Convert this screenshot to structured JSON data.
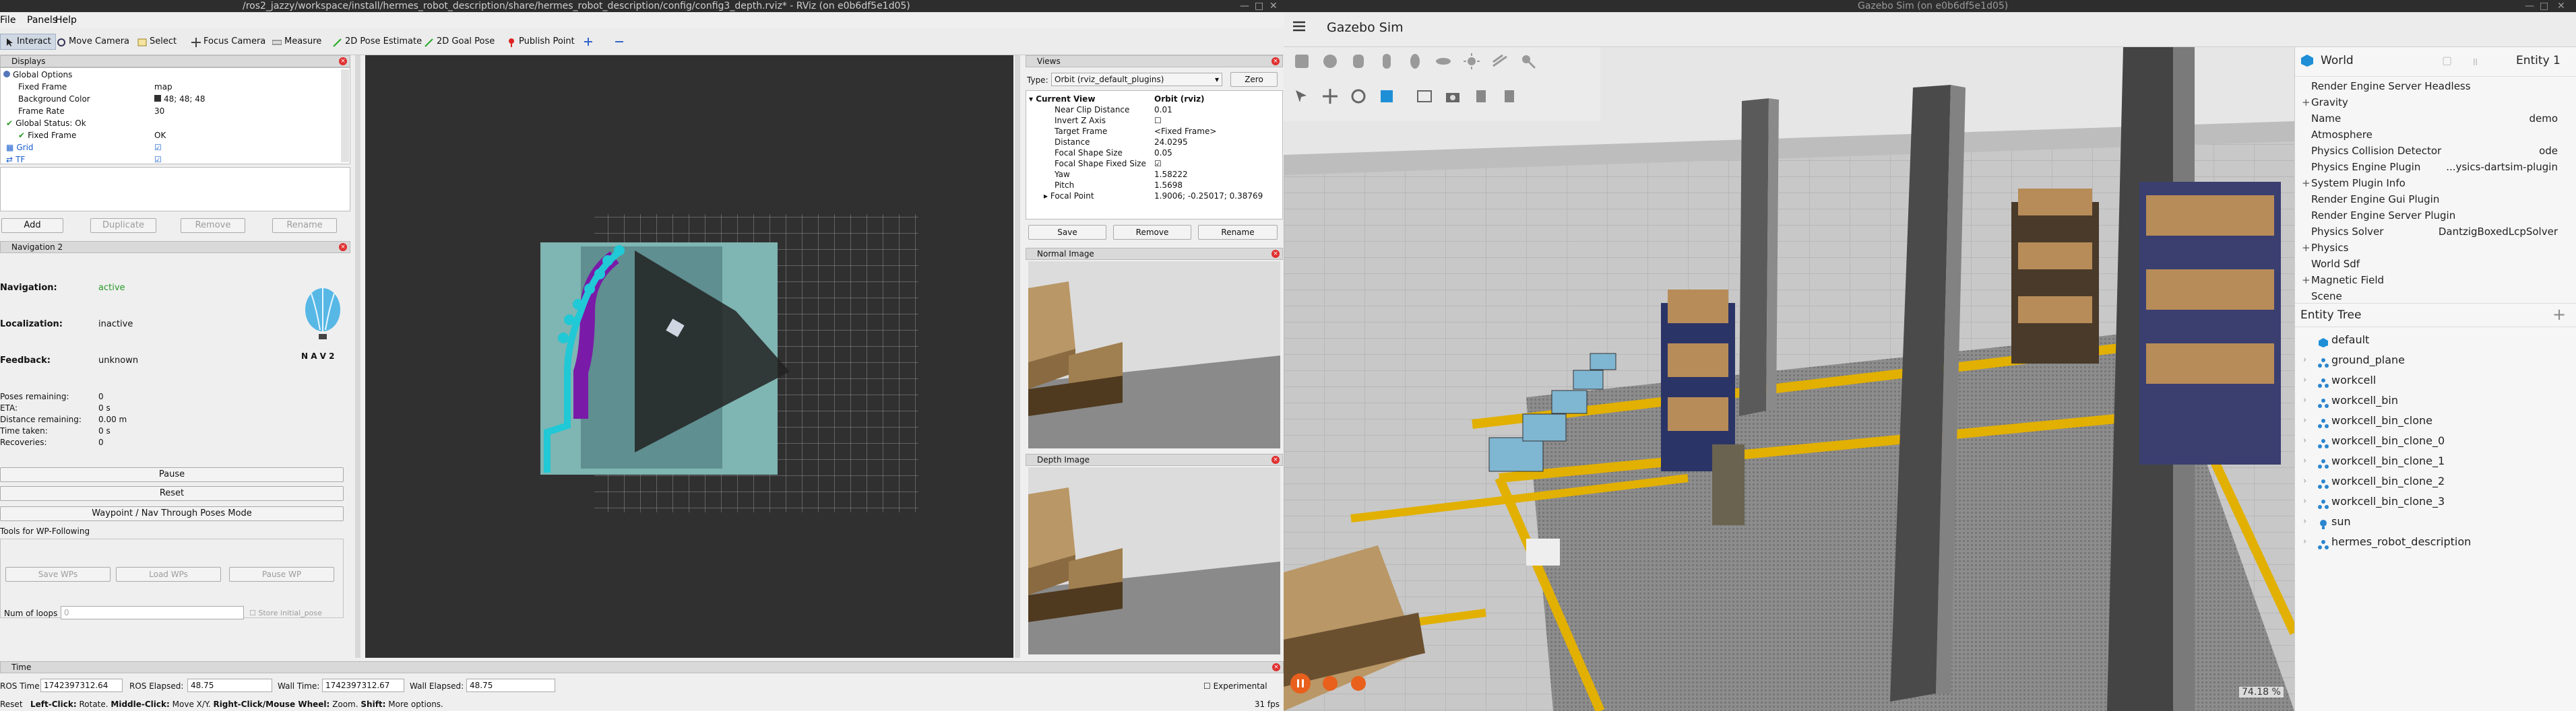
{
  "rviz": {
    "window_title": "/ros2_jazzy/workspace/install/hermes_robot_description/share/hermes_robot_description/config/config3_depth.rviz* - RViz (on e0b6df5e1d05)",
    "menu": [
      "File",
      "Panels",
      "Help"
    ],
    "toolbar": [
      "Interact",
      "Move Camera",
      "Select",
      "Focus Camera",
      "Measure",
      "2D Pose Estimate",
      "2D Goal Pose",
      "Publish Point"
    ],
    "displays": {
      "title": "Displays",
      "rows": [
        {
          "label": "Global Options",
          "value": ""
        },
        {
          "label": "Fixed Frame",
          "value": "map"
        },
        {
          "label": "Background Color",
          "value": "48; 48; 48"
        },
        {
          "label": "Frame Rate",
          "value": "30"
        },
        {
          "label": "Global Status: Ok",
          "value": ""
        },
        {
          "label": "Fixed Frame",
          "value": "OK"
        },
        {
          "label": "Grid",
          "value": ""
        },
        {
          "label": "TF",
          "value": ""
        }
      ],
      "buttons": [
        "Add",
        "Duplicate",
        "Remove",
        "Rename"
      ]
    },
    "nav2": {
      "title": "Navigation 2",
      "status": [
        {
          "label": "Navigation:",
          "value": "active"
        },
        {
          "label": "Localization:",
          "value": "inactive"
        },
        {
          "label": "Feedback:",
          "value": "unknown"
        }
      ],
      "logo_text": "N A V 2",
      "metrics": [
        {
          "label": "Poses remaining:",
          "value": "0"
        },
        {
          "label": "ETA:",
          "value": "0 s"
        },
        {
          "label": "Distance remaining:",
          "value": "0.00 m"
        },
        {
          "label": "Time taken:",
          "value": "0 s"
        },
        {
          "label": "Recoveries:",
          "value": "0"
        }
      ],
      "buttons": [
        "Pause",
        "Reset",
        "Waypoint / Nav Through Poses Mode"
      ],
      "wp_title": "Tools for WP-Following",
      "wp_buttons": [
        "Save WPs",
        "Load WPs",
        "Pause WP"
      ],
      "loops_label": "Num of loops",
      "loops_value": "0",
      "store_initial": "Store initial_pose"
    },
    "views": {
      "title": "Views",
      "type_label": "Type:",
      "type_value": "Orbit (rviz_default_plugins)",
      "zero": "Zero",
      "rows": [
        {
          "label": "Current View",
          "value": "Orbit (rviz)"
        },
        {
          "label": "Near Clip Distance",
          "value": "0.01"
        },
        {
          "label": "Invert Z Axis",
          "value": ""
        },
        {
          "label": "Target Frame",
          "value": "<Fixed Frame>"
        },
        {
          "label": "Distance",
          "value": "24.0295"
        },
        {
          "label": "Focal Shape Size",
          "value": "0.05"
        },
        {
          "label": "Focal Shape Fixed Size",
          "value": ""
        },
        {
          "label": "Yaw",
          "value": "1.58222"
        },
        {
          "label": "Pitch",
          "value": "1.5698"
        },
        {
          "label": "Focal Point",
          "value": "1.9006; -0.25017; 0.38769"
        }
      ],
      "buttons": [
        "Save",
        "Remove",
        "Rename"
      ]
    },
    "normal_image": {
      "title": "Normal Image"
    },
    "depth_image": {
      "title": "Depth Image"
    },
    "time": {
      "title": "Time",
      "ros_time_label": "ROS Time:",
      "ros_time": "1742397312.64",
      "ros_elapsed_label": "ROS Elapsed:",
      "ros_elapsed": "48.75",
      "wall_time_label": "Wall Time:",
      "wall_time": "1742397312.67",
      "wall_elapsed_label": "Wall Elapsed:",
      "wall_elapsed": "48.75",
      "experimental": "Experimental"
    },
    "status_bar": {
      "reset": "Reset",
      "hint_l": "Left-Click:",
      "hint_l_v": "Rotate.",
      "hint_m": "Middle-Click:",
      "hint_m_v": "Move X/Y.",
      "hint_r": "Right-Click/Mouse Wheel:",
      "hint_r_v": "Zoom.",
      "hint_s": "Shift:",
      "hint_s_v": "More options.",
      "fps": "31 fps"
    },
    "colors": {
      "panel_bg": "#efefef",
      "view_bg": "#303030",
      "map_cyan": "#21c8d6",
      "costmap_purple": "#7a1aa8"
    }
  },
  "gazebo": {
    "window_title": "Gazebo Sim (on e0b6df5e1d05)",
    "app_title": "Gazebo Sim",
    "world": {
      "title": "World",
      "entity": "Entity 1",
      "rows": [
        {
          "label": "Render Engine Server Headless",
          "value": "",
          "plus": ""
        },
        {
          "label": "Gravity",
          "value": "",
          "plus": "+"
        },
        {
          "label": "Name",
          "value": "demo",
          "plus": ""
        },
        {
          "label": "Atmosphere",
          "value": "",
          "plus": ""
        },
        {
          "label": "Physics Collision Detector",
          "value": "ode",
          "plus": ""
        },
        {
          "label": "Physics Engine Plugin",
          "value": "...ysics-dartsim-plugin",
          "plus": ""
        },
        {
          "label": "System Plugin Info",
          "value": "",
          "plus": "+"
        },
        {
          "label": "Render Engine Gui Plugin",
          "value": "",
          "plus": ""
        },
        {
          "label": "Render Engine Server Plugin",
          "value": "",
          "plus": ""
        },
        {
          "label": "Physics Solver",
          "value": "DantzigBoxedLcpSolver",
          "plus": ""
        },
        {
          "label": "Physics",
          "value": "",
          "plus": "+"
        },
        {
          "label": "World Sdf",
          "value": "",
          "plus": ""
        },
        {
          "label": "Magnetic Field",
          "value": "",
          "plus": "+"
        },
        {
          "label": "Scene",
          "value": "",
          "plus": ""
        }
      ]
    },
    "entity_tree": {
      "title": "Entity Tree",
      "items": [
        "default",
        "ground_plane",
        "workcell",
        "workcell_bin",
        "workcell_bin_clone",
        "workcell_bin_clone_0",
        "workcell_bin_clone_1",
        "workcell_bin_clone_2",
        "workcell_bin_clone_3",
        "sun",
        "hermes_robot_description"
      ]
    },
    "rtf": "74.18 %",
    "colors": {
      "accent": "#1e8fd6",
      "play": "#e8601c",
      "floor": "#c9c9c9",
      "stripe": "#e2b000"
    }
  }
}
